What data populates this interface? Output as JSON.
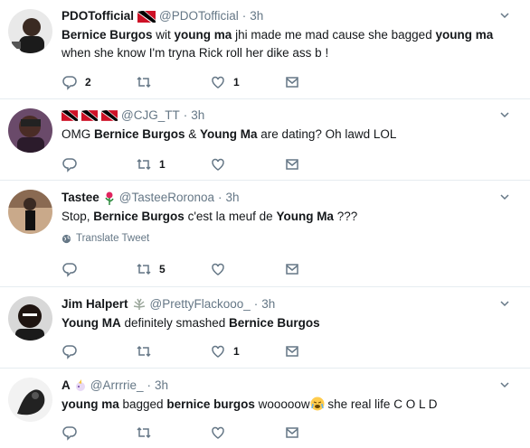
{
  "tweets": [
    {
      "name": "PDOTofficial",
      "handle": "@PDOTofficial",
      "time": "3h",
      "segments": [
        {
          "t": "Bernice Burgos",
          "b": true
        },
        {
          "t": " wit ",
          "b": false
        },
        {
          "t": "young ma",
          "b": true
        },
        {
          "t": " jhi made me mad cause she bagged ",
          "b": false
        },
        {
          "t": "young ma",
          "b": true
        },
        {
          "t": " when she know I'm tryna Rick roll her dike ass b !",
          "b": false
        }
      ],
      "replies": "2",
      "retweets": "",
      "likes": "1"
    },
    {
      "name": "",
      "handle": "@CJG_TT",
      "time": "3h",
      "segments": [
        {
          "t": "OMG ",
          "b": false
        },
        {
          "t": "Bernice Burgos",
          "b": true
        },
        {
          "t": " & ",
          "b": false
        },
        {
          "t": "Young Ma",
          "b": true
        },
        {
          "t": " are dating? Oh lawd LOL",
          "b": false
        }
      ],
      "replies": "",
      "retweets": "1",
      "likes": ""
    },
    {
      "name": "Tastee",
      "handle": "@TasteeRoronoa",
      "time": "3h",
      "segments": [
        {
          "t": "Stop, ",
          "b": false
        },
        {
          "t": "Bernice Burgos",
          "b": true
        },
        {
          "t": " c'est la meuf de ",
          "b": false
        },
        {
          "t": "Young Ma",
          "b": true
        },
        {
          "t": " ???",
          "b": false
        }
      ],
      "translate": "Translate Tweet",
      "replies": "",
      "retweets": "5",
      "likes": ""
    },
    {
      "name": "Jim Halpert",
      "handle": "@PrettyFlackooo_",
      "time": "3h",
      "segments": [
        {
          "t": "Young MA",
          "b": true
        },
        {
          "t": " definitely smashed ",
          "b": false
        },
        {
          "t": "Bernice Burgos",
          "b": true
        }
      ],
      "replies": "",
      "retweets": "",
      "likes": "1"
    },
    {
      "name": "A",
      "handle": "@Arrrrie_",
      "time": "3h",
      "segments": [
        {
          "t": "young ma",
          "b": true
        },
        {
          "t": " bagged ",
          "b": false
        },
        {
          "t": "bernice burgos",
          "b": true
        },
        {
          "t": " wooooow",
          "b": false
        },
        {
          "t": "",
          "b": false,
          "emoji": "weary-face"
        },
        {
          "t": " she real life C O L D",
          "b": false
        }
      ],
      "replies": "",
      "retweets": "",
      "likes": ""
    }
  ],
  "icons": {
    "reply": "reply-icon",
    "retweet": "retweet-icon",
    "like": "heart-icon",
    "dm": "envelope-icon",
    "caret": "chevron-down-icon",
    "globe": "globe-icon"
  },
  "colors": {
    "text": "#14171a",
    "muted": "#657786",
    "divider": "#e6ecf0"
  }
}
